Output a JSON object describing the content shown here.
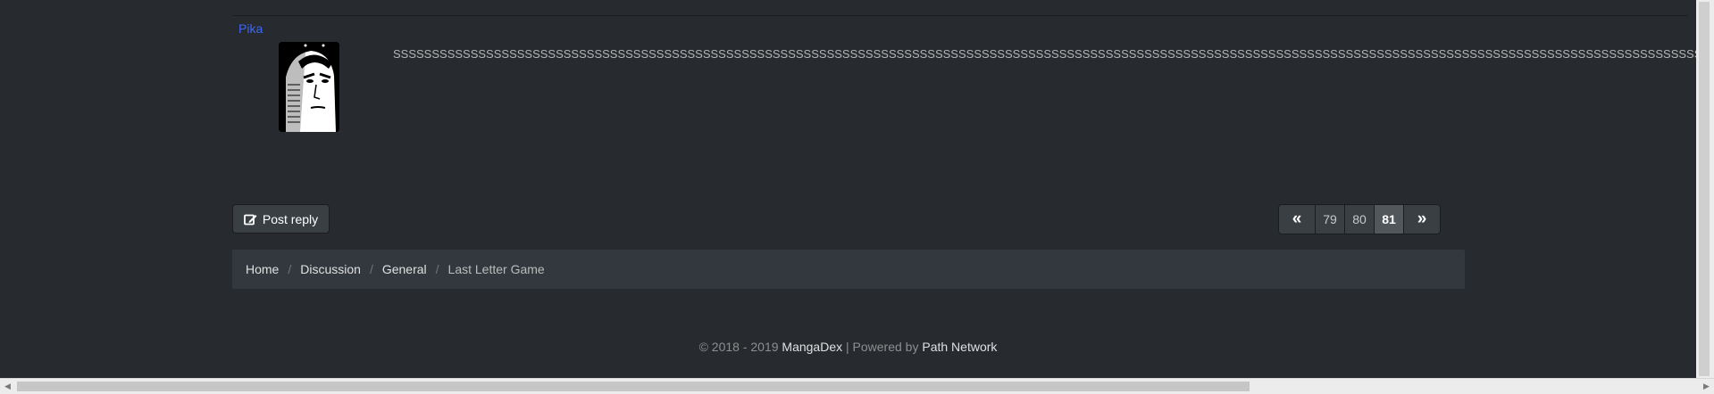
{
  "post": {
    "username": "Pika",
    "body": "SSSSSSSSSSSSSSSSSSSSSSSSSSSSSSSSSSSSSSSSSSSSSSSSSSSSSSSSSSSSSSSSSSSSSSSSSSSSSSSSSSSSSSSSSSSSSSSSSSSSSSSSSSSSSSSSSSSSSSSSSSSSSSSSSSSSSSSSSSSSSSSSSSSSSSSSSSSSSSSSSSSSSSSSSSSSSSSSSSSSSSSSSSSSSSSSSSSSSSSSSSSSSSSSSSSSSSSSSSSSSSSSSSSSSSSSSSSS"
  },
  "actions": {
    "reply_label": "Post reply"
  },
  "pagination": {
    "first_icon": "«",
    "last_icon": "»",
    "pages": [
      "79",
      "80",
      "81"
    ],
    "current": "81"
  },
  "breadcrumb": {
    "items": [
      "Home",
      "Discussion",
      "General",
      "Last Letter Game"
    ],
    "separator": "/"
  },
  "footer": {
    "copyright": "© 2018 - 2019",
    "site": "MangaDex",
    "powered_prefix": "| Powered by",
    "network": "Path Network"
  },
  "colors": {
    "background": "#272b30",
    "username": "#3d67f5",
    "button": "#3a3f44",
    "active_page": "#52575c",
    "breadcrumb_bg": "#32383e"
  },
  "icons": {
    "reply": "edit-icon",
    "first": "double-chevron-left-icon",
    "last": "double-chevron-right-icon"
  }
}
